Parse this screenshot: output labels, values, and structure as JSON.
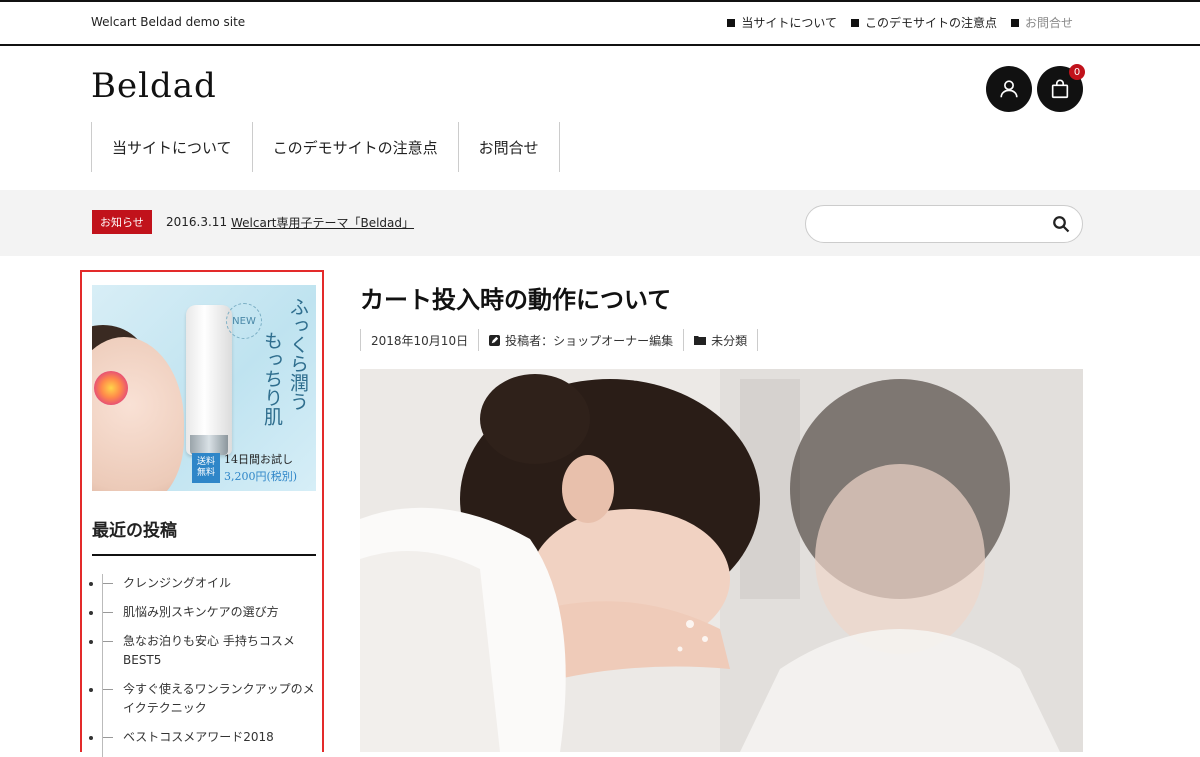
{
  "topbar": {
    "site_tag": "Welcart Beldad demo site",
    "links": [
      {
        "label": "当サイトについて"
      },
      {
        "label": "このデモサイトの注意点"
      },
      {
        "label": "お問合せ"
      }
    ]
  },
  "header": {
    "logo": "Beldad",
    "cart_count": "0"
  },
  "main_nav": [
    {
      "label": "当サイトについて"
    },
    {
      "label": "このデモサイトの注意点"
    },
    {
      "label": "お問合せ"
    }
  ],
  "notice": {
    "label": "お知らせ",
    "date": "2016.3.11",
    "link": "Welcart専用子テーマ「Beldad」"
  },
  "search": {
    "placeholder": "",
    "value": ""
  },
  "banner": {
    "badge": "NEW",
    "copy_line1": "ふっくら潤う",
    "copy_line2": "もっちり肌",
    "shipping_line1": "送料",
    "shipping_line2": "無料",
    "trial": "14日間お試し",
    "price": "3,200円(税別)"
  },
  "sidebar": {
    "widget_title": "最近の投稿",
    "posts": [
      {
        "title": "クレンジングオイル"
      },
      {
        "title": "肌悩み別スキンケアの選び方"
      },
      {
        "title": "急なお泊りも安心 手持ちコスメBEST5"
      },
      {
        "title": "今すぐ使えるワンランクアップのメイクテクニック"
      },
      {
        "title": "ベストコスメアワード2018"
      }
    ]
  },
  "article": {
    "title": "カート投入時の動作について",
    "date": "2018年10月10日",
    "author": "投稿者：ショップオーナー編集",
    "category": "未分類"
  },
  "colors": {
    "accent_red": "#c1121b",
    "frame_red": "#e32a2a",
    "text": "#222222",
    "band_gray": "#f3f3f3"
  }
}
